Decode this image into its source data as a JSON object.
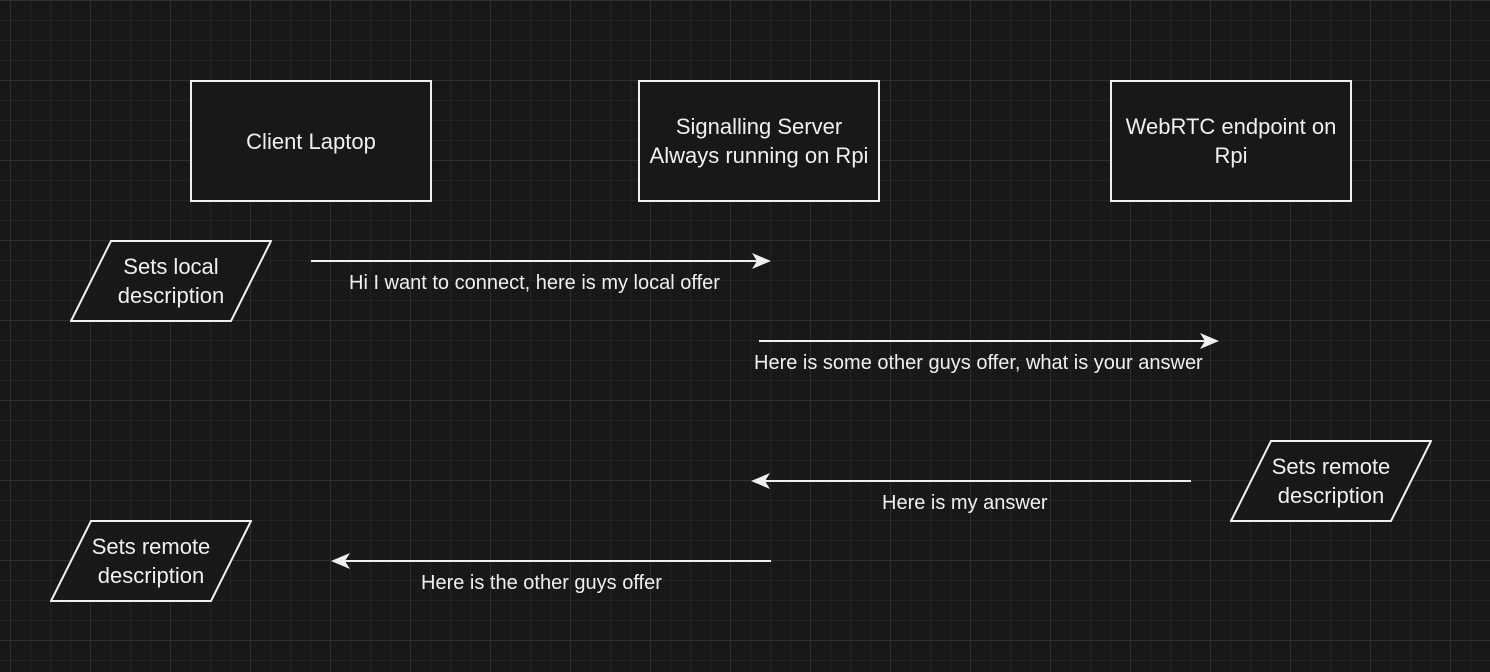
{
  "colors": {
    "background": "#181818",
    "stroke": "#f0f0f0",
    "text": "#f0f0f0"
  },
  "participants": {
    "client": "Client Laptop",
    "server": "Signalling Server\nAlways running on Rpi",
    "endpoint": "WebRTC endpoint on Rpi"
  },
  "actions": {
    "client_set_local": "Sets local\ndescription",
    "endpoint_set_remote": "Sets remote\ndescription",
    "client_set_remote": "Sets remote\ndescription"
  },
  "messages": {
    "client_to_server": "Hi I want to connect, here is my local offer",
    "server_to_endpoint": "Here is some other guys offer, what is your answer",
    "endpoint_to_server": "Here is my answer",
    "server_to_client": "Here is the other guys offer"
  }
}
